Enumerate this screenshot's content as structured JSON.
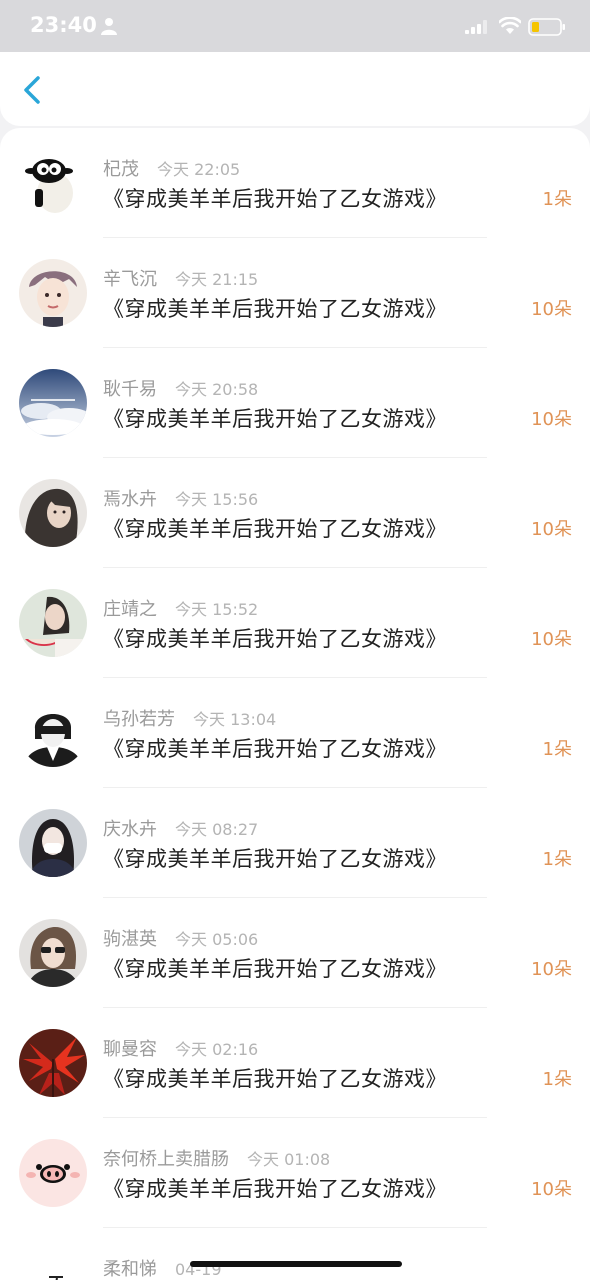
{
  "status_bar": {
    "time": "23:40"
  },
  "list": {
    "items": [
      {
        "name": "杞茂",
        "time": "今天 22:05",
        "title": "《穿成美羊羊后我开始了乙女游戏》",
        "count": "1朵"
      },
      {
        "name": "辛飞沉",
        "time": "今天 21:15",
        "title": "《穿成美羊羊后我开始了乙女游戏》",
        "count": "10朵"
      },
      {
        "name": "耿千易",
        "time": "今天 20:58",
        "title": "《穿成美羊羊后我开始了乙女游戏》",
        "count": "10朵"
      },
      {
        "name": "焉水卉",
        "time": "今天 15:56",
        "title": "《穿成美羊羊后我开始了乙女游戏》",
        "count": "10朵"
      },
      {
        "name": "庄靖之",
        "time": "今天 15:52",
        "title": "《穿成美羊羊后我开始了乙女游戏》",
        "count": "10朵"
      },
      {
        "name": "乌孙若芳",
        "time": "今天 13:04",
        "title": "《穿成美羊羊后我开始了乙女游戏》",
        "count": "1朵"
      },
      {
        "name": "庆水卉",
        "time": "今天 08:27",
        "title": "《穿成美羊羊后我开始了乙女游戏》",
        "count": "1朵"
      },
      {
        "name": "驹湛英",
        "time": "今天 05:06",
        "title": "《穿成美羊羊后我开始了乙女游戏》",
        "count": "10朵"
      },
      {
        "name": "聊曼容",
        "time": "今天 02:16",
        "title": "《穿成美羊羊后我开始了乙女游戏》",
        "count": "1朵"
      },
      {
        "name": "奈何桥上卖腊肠",
        "time": "今天 01:08",
        "title": "《穿成美羊羊后我开始了乙女游戏》",
        "count": "10朵"
      },
      {
        "name": "柔和悌",
        "time": "04-19",
        "title": "",
        "count": ""
      }
    ]
  },
  "colors": {
    "accent": "#2aa6d8",
    "count": "#e09356"
  },
  "icons": [
    "person-icon",
    "signal-icon",
    "wifi-icon",
    "battery-icon",
    "back-chevron-icon"
  ]
}
